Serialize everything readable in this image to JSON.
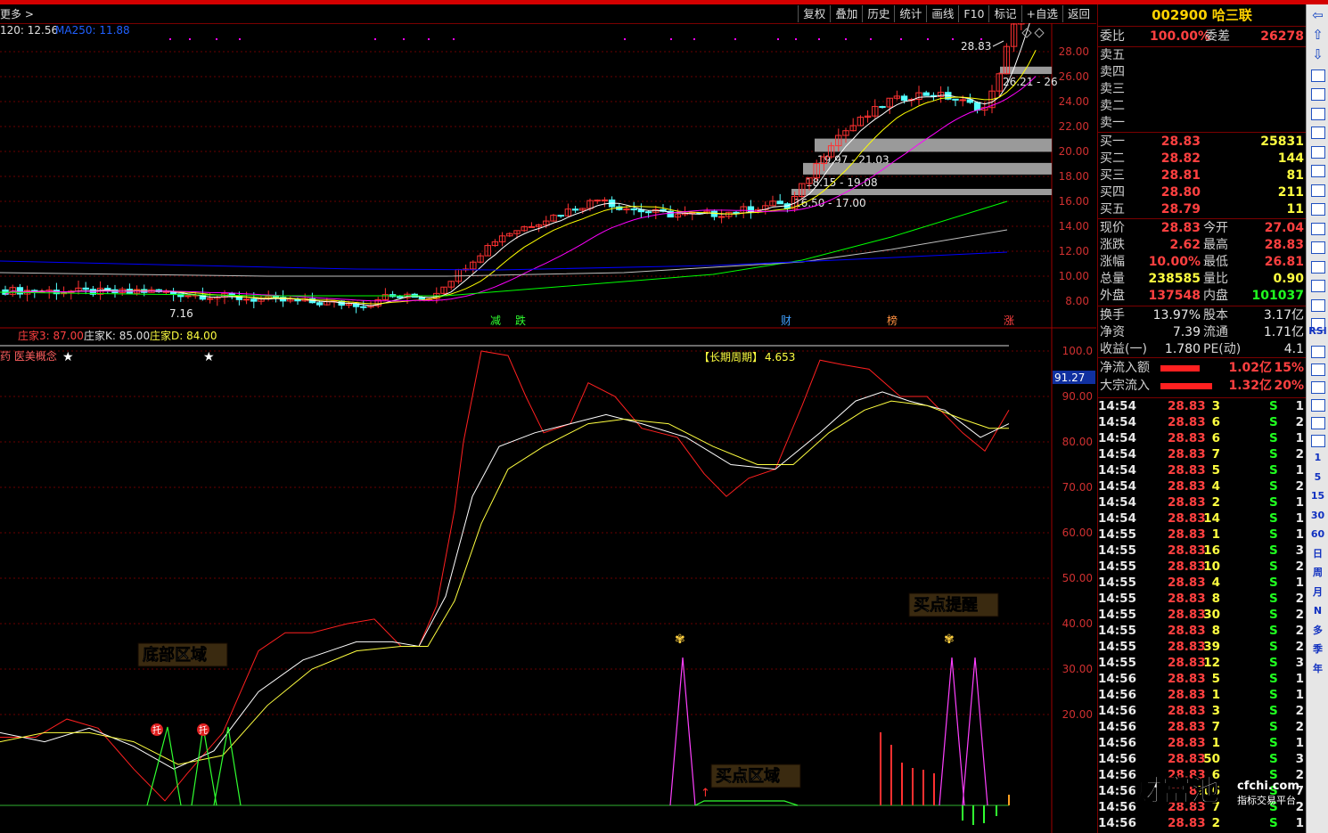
{
  "toolbar": {
    "left_label": "更多 >",
    "buttons": [
      "复权",
      "叠加",
      "历史",
      "统计",
      "画线",
      "F10",
      "标记",
      "+自选",
      "返回"
    ]
  },
  "main_chart": {
    "ma_legend": "120: 12.56",
    "ma250_legend": "MA250: 11.88",
    "price_ticks": [
      "28.00",
      "26.00",
      "24.00",
      "22.00",
      "20.00",
      "18.00",
      "16.00",
      "14.00",
      "12.00",
      "10.00",
      "8.00"
    ],
    "high_label": "28.83",
    "low_label": "7.16",
    "zones": [
      {
        "label": "26.21 - 26",
        "lo": 26.21,
        "hi": 26.8
      },
      {
        "label": "19.97 - 21.03",
        "lo": 19.97,
        "hi": 21.03
      },
      {
        "label": "18.15 - 19.08",
        "lo": 18.15,
        "hi": 19.08
      },
      {
        "label": "16.50 - 17.00",
        "lo": 16.5,
        "hi": 17.0
      }
    ],
    "markers": [
      {
        "text": "减",
        "color": "#30ff30"
      },
      {
        "text": "跌",
        "color": "#30ff30"
      },
      {
        "text": "财",
        "color": "#40a0ff"
      },
      {
        "text": "榜",
        "color": "#ff9040"
      },
      {
        "text": "涨",
        "color": "#ff4040"
      }
    ]
  },
  "indicator": {
    "legend": {
      "z3": "庄家3: 87.00",
      "zk": "庄家K: 85.00",
      "zd": "庄家D: 84.00"
    },
    "concept": "药 医美概念",
    "period_label": "【长期周期】",
    "period_value": "4.653",
    "current_value": "91.27",
    "ticks": [
      "100.0",
      "90.00",
      "80.00",
      "70.00",
      "60.00",
      "50.00",
      "40.00",
      "30.00",
      "20.00"
    ],
    "annotations": {
      "bottom_zone": "底部区域",
      "buy_zone": "买点区域",
      "buy_alert": "买点提醒"
    },
    "tuo": "托"
  },
  "quote": {
    "code": "002900",
    "name": "哈三联",
    "weibi_label": "委比",
    "weibi_value": "100.00%",
    "weicha_label": "委差",
    "weicha_value": "26278",
    "sell": [
      {
        "label": "卖五",
        "price": "",
        "vol": ""
      },
      {
        "label": "卖四",
        "price": "",
        "vol": ""
      },
      {
        "label": "卖三",
        "price": "",
        "vol": ""
      },
      {
        "label": "卖二",
        "price": "",
        "vol": ""
      },
      {
        "label": "卖一",
        "price": "",
        "vol": ""
      }
    ],
    "buy": [
      {
        "label": "买一",
        "price": "28.83",
        "vol": "25831"
      },
      {
        "label": "买二",
        "price": "28.82",
        "vol": "144"
      },
      {
        "label": "买三",
        "price": "28.81",
        "vol": "81"
      },
      {
        "label": "买四",
        "price": "28.80",
        "vol": "211"
      },
      {
        "label": "买五",
        "price": "28.79",
        "vol": "11"
      }
    ],
    "stats": [
      {
        "l1": "现价",
        "v1": "28.83",
        "c1": "red",
        "l2": "今开",
        "v2": "27.04",
        "c2": "red"
      },
      {
        "l1": "涨跌",
        "v1": "2.62",
        "c1": "red",
        "l2": "最高",
        "v2": "28.83",
        "c2": "red"
      },
      {
        "l1": "涨幅",
        "v1": "10.00%",
        "c1": "red",
        "l2": "最低",
        "v2": "26.81",
        "c2": "red"
      },
      {
        "l1": "总量",
        "v1": "238585",
        "c1": "yel",
        "l2": "量比",
        "v2": "0.90",
        "c2": "yel"
      },
      {
        "l1": "外盘",
        "v1": "137548",
        "c1": "red",
        "l2": "内盘",
        "v2": "101037",
        "c2": "grn"
      }
    ],
    "stats2": [
      {
        "l1": "换手",
        "v1": "13.97%",
        "l2": "股本",
        "v2": "3.17亿"
      },
      {
        "l1": "净资",
        "v1": "7.39",
        "l2": "流通",
        "v2": "1.71亿"
      },
      {
        "l1": "收益(一)",
        "v1": "1.780",
        "l2": "PE(动)",
        "v2": "4.1"
      }
    ],
    "flows": [
      {
        "label": "净流入额",
        "value": "1.02亿",
        "pct": "15%",
        "bar": 0.15
      },
      {
        "label": "大宗流入",
        "value": "1.32亿",
        "pct": "20%",
        "bar": 0.2
      }
    ],
    "ticks": [
      [
        "14:54",
        "28.83",
        "3",
        "S",
        "1"
      ],
      [
        "14:54",
        "28.83",
        "6",
        "S",
        "2"
      ],
      [
        "14:54",
        "28.83",
        "6",
        "S",
        "1"
      ],
      [
        "14:54",
        "28.83",
        "7",
        "S",
        "2"
      ],
      [
        "14:54",
        "28.83",
        "5",
        "S",
        "1"
      ],
      [
        "14:54",
        "28.83",
        "4",
        "S",
        "2"
      ],
      [
        "14:54",
        "28.83",
        "2",
        "S",
        "1"
      ],
      [
        "14:54",
        "28.83",
        "14",
        "S",
        "1"
      ],
      [
        "14:55",
        "28.83",
        "1",
        "S",
        "1"
      ],
      [
        "14:55",
        "28.83",
        "16",
        "S",
        "3"
      ],
      [
        "14:55",
        "28.83",
        "10",
        "S",
        "2"
      ],
      [
        "14:55",
        "28.83",
        "4",
        "S",
        "1"
      ],
      [
        "14:55",
        "28.83",
        "8",
        "S",
        "2"
      ],
      [
        "14:55",
        "28.83",
        "30",
        "S",
        "2"
      ],
      [
        "14:55",
        "28.83",
        "8",
        "S",
        "2"
      ],
      [
        "14:55",
        "28.83",
        "39",
        "S",
        "2"
      ],
      [
        "14:55",
        "28.83",
        "12",
        "S",
        "3"
      ],
      [
        "14:56",
        "28.83",
        "5",
        "S",
        "1"
      ],
      [
        "14:56",
        "28.83",
        "1",
        "S",
        "1"
      ],
      [
        "14:56",
        "28.83",
        "3",
        "S",
        "2"
      ],
      [
        "14:56",
        "28.83",
        "7",
        "S",
        "2"
      ],
      [
        "14:56",
        "28.83",
        "1",
        "S",
        "1"
      ],
      [
        "14:56",
        "28.83",
        "50",
        "S",
        "3"
      ],
      [
        "14:56",
        "28.83",
        "6",
        "S",
        "2"
      ],
      [
        "14:56",
        "28.83",
        "206",
        "S",
        "7"
      ],
      [
        "14:56",
        "28.83",
        "7",
        "S",
        "2"
      ],
      [
        "14:56",
        "28.83",
        "2",
        "S",
        "1"
      ]
    ]
  },
  "sidebar": {
    "text_items": [
      "RSI",
      "1",
      "5",
      "15",
      "30",
      "60",
      "日",
      "周",
      "月",
      "N",
      "多",
      "季",
      "年"
    ]
  },
  "watermark": {
    "brand": "财富池",
    "site": "cfchi.com",
    "tagline": "指标交易平台"
  },
  "colors": {
    "up": "#ff3232",
    "down": "#54ffff",
    "ma5": "#ffffff",
    "ma10": "#ffff00",
    "ma20": "#ff00ff",
    "ma60": "#00ff00",
    "ma120": "#0050ff",
    "ma250": "#0000ff",
    "accent_red": "#d40000"
  }
}
